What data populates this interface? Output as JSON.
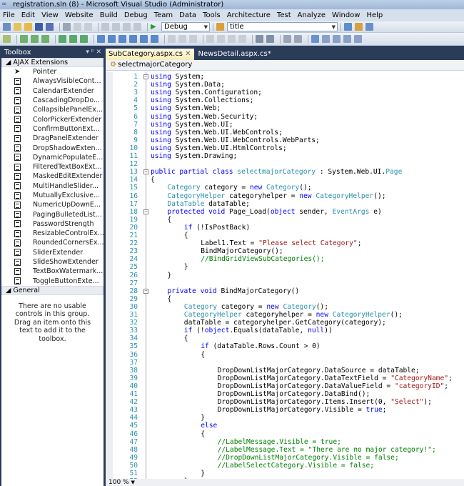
{
  "window": {
    "title": "registration.sln (8) - Microsoft Visual Studio (Administrator)"
  },
  "menu": [
    "File",
    "Edit",
    "View",
    "Website",
    "Build",
    "Debug",
    "Team",
    "Data",
    "Tools",
    "Architecture",
    "Test",
    "Analyze",
    "Window",
    "Help"
  ],
  "toolbar": {
    "config": "Debug",
    "find": "title"
  },
  "colors": {
    "keyword": "#0000ff",
    "type": "#2b91af",
    "string": "#a31515",
    "comment": "#008000",
    "frame": "#2b3c59"
  },
  "toolbox": {
    "title": "Toolbox",
    "controls": "▾ ᵖ ✕",
    "groups": [
      {
        "name": "AJAX Extensions",
        "items": [
          "Pointer",
          "AlwaysVisibleCont...",
          "CalendarExtender",
          "CascadingDropDo...",
          "CollapsiblePanelEx...",
          "ColorPickerExtender",
          "ConfirmButtonExt...",
          "DragPanelExtender",
          "DropShadowExten...",
          "DynamicPopulateE...",
          "FilteredTextBoxExt...",
          "MaskedEditExtender",
          "MultiHandleSlider...",
          "MutuallyExclusive...",
          "NumericUpDownE...",
          "PagingBulletedList...",
          "PasswordStrength",
          "ResizableControlEx...",
          "RoundedCornersEx...",
          "SliderExtender",
          "SlideShowExtender",
          "TextBoxWatermark...",
          "ToggleButtonExte..."
        ]
      },
      {
        "name": "General",
        "items": []
      }
    ],
    "empty_message": "There are no usable controls in this group. Drag an item onto this text to add it to the toolbox."
  },
  "editor": {
    "tabs": [
      {
        "label": "SubCategory.aspx.cs",
        "close": "✕"
      },
      {
        "label": "NewsDetail.aspx.cs*"
      }
    ],
    "nav": "selectmajorCategory",
    "zoom": "100 %",
    "lines": [
      [
        0,
        [
          [
            "kw",
            "using"
          ],
          [
            "pl",
            " System;"
          ]
        ]
      ],
      [
        0,
        [
          [
            "kw",
            "using"
          ],
          [
            "pl",
            " System.Data;"
          ]
        ]
      ],
      [
        0,
        [
          [
            "kw",
            "using"
          ],
          [
            "pl",
            " System.Configuration;"
          ]
        ]
      ],
      [
        0,
        [
          [
            "kw",
            "using"
          ],
          [
            "pl",
            " System.Collections;"
          ]
        ]
      ],
      [
        0,
        [
          [
            "kw",
            "using"
          ],
          [
            "pl",
            " System.Web;"
          ]
        ]
      ],
      [
        0,
        [
          [
            "kw",
            "using"
          ],
          [
            "pl",
            " System.Web.Security;"
          ]
        ]
      ],
      [
        0,
        [
          [
            "kw",
            "using"
          ],
          [
            "pl",
            " System.Web.UI;"
          ]
        ]
      ],
      [
        0,
        [
          [
            "kw",
            "using"
          ],
          [
            "pl",
            " System.Web.UI.WebControls;"
          ]
        ]
      ],
      [
        0,
        [
          [
            "kw",
            "using"
          ],
          [
            "pl",
            " System.Web.UI.WebControls.WebParts;"
          ]
        ]
      ],
      [
        0,
        [
          [
            "kw",
            "using"
          ],
          [
            "pl",
            " System.Web.UI.HtmlControls;"
          ]
        ]
      ],
      [
        0,
        [
          [
            "kw",
            "using"
          ],
          [
            "pl",
            " System.Drawing;"
          ]
        ]
      ],
      [
        0,
        []
      ],
      [
        0,
        [
          [
            "kw",
            "public partial class "
          ],
          [
            "ty",
            "selectmajorCategory"
          ],
          [
            "pl",
            " : System.Web.UI."
          ],
          [
            "ty",
            "Page"
          ]
        ]
      ],
      [
        0,
        [
          [
            "pl",
            "{"
          ]
        ]
      ],
      [
        4,
        [
          [
            "ty",
            "Category"
          ],
          [
            "pl",
            " category = "
          ],
          [
            "kw",
            "new "
          ],
          [
            "ty",
            "Category"
          ],
          [
            "pl",
            "();"
          ]
        ]
      ],
      [
        4,
        [
          [
            "ty",
            "CategoryHelper"
          ],
          [
            "pl",
            " categoryhelper = "
          ],
          [
            "kw",
            "new "
          ],
          [
            "ty",
            "CategoryHelper"
          ],
          [
            "pl",
            "();"
          ]
        ]
      ],
      [
        4,
        [
          [
            "ty",
            "DataTable"
          ],
          [
            "pl",
            " dataTable;"
          ]
        ]
      ],
      [
        4,
        [
          [
            "kw",
            "protected void"
          ],
          [
            "pl",
            " Page_Load("
          ],
          [
            "kw",
            "object"
          ],
          [
            "pl",
            " sender, "
          ],
          [
            "ty",
            "EventArgs"
          ],
          [
            "pl",
            " e)"
          ]
        ]
      ],
      [
        4,
        [
          [
            "pl",
            "{"
          ]
        ]
      ],
      [
        8,
        [
          [
            "kw",
            "if"
          ],
          [
            "pl",
            " (!IsPostBack)"
          ]
        ]
      ],
      [
        8,
        [
          [
            "pl",
            "{"
          ]
        ]
      ],
      [
        12,
        [
          [
            "pl",
            "Label1.Text = "
          ],
          [
            "st",
            "\"Please select Category\""
          ],
          [
            "pl",
            ";"
          ]
        ]
      ],
      [
        12,
        [
          [
            "pl",
            "BindMajorCategory();"
          ]
        ]
      ],
      [
        12,
        [
          [
            "cm",
            "//BindGridViewSubCategories();"
          ]
        ]
      ],
      [
        8,
        [
          [
            "pl",
            "}"
          ]
        ]
      ],
      [
        4,
        [
          [
            "pl",
            "}"
          ]
        ]
      ],
      [
        0,
        []
      ],
      [
        4,
        [
          [
            "kw",
            "private void"
          ],
          [
            "pl",
            " BindMajorCategory()"
          ]
        ]
      ],
      [
        4,
        [
          [
            "pl",
            "{"
          ]
        ]
      ],
      [
        8,
        [
          [
            "ty",
            "Category"
          ],
          [
            "pl",
            " category = "
          ],
          [
            "kw",
            "new "
          ],
          [
            "ty",
            "Category"
          ],
          [
            "pl",
            "();"
          ]
        ]
      ],
      [
        8,
        [
          [
            "ty",
            "CategoryHelper"
          ],
          [
            "pl",
            " categoryhelper = "
          ],
          [
            "kw",
            "new "
          ],
          [
            "ty",
            "CategoryHelper"
          ],
          [
            "pl",
            "();"
          ]
        ]
      ],
      [
        8,
        [
          [
            "pl",
            "dataTable = categoryhelper.GetCategory(category);"
          ]
        ]
      ],
      [
        8,
        [
          [
            "kw",
            "if"
          ],
          [
            "pl",
            " (!"
          ],
          [
            "kw",
            "object"
          ],
          [
            "pl",
            ".Equals(dataTable, "
          ],
          [
            "kw",
            "null"
          ],
          [
            "pl",
            "))"
          ]
        ]
      ],
      [
        8,
        [
          [
            "pl",
            "{"
          ]
        ]
      ],
      [
        12,
        [
          [
            "kw",
            "if"
          ],
          [
            "pl",
            " (dataTable.Rows.Count > 0)"
          ]
        ]
      ],
      [
        12,
        [
          [
            "pl",
            "{"
          ]
        ]
      ],
      [
        0,
        []
      ],
      [
        16,
        [
          [
            "pl",
            "DropDownListMajorCategory.DataSource = dataTable;"
          ]
        ]
      ],
      [
        16,
        [
          [
            "pl",
            "DropDownListMajorCategory.DataTextField = "
          ],
          [
            "st",
            "\"CategoryName\""
          ],
          [
            "pl",
            ";"
          ]
        ]
      ],
      [
        16,
        [
          [
            "pl",
            "DropDownListMajorCategory.DataValueField = "
          ],
          [
            "st",
            "\"categoryID\""
          ],
          [
            "pl",
            ";"
          ]
        ]
      ],
      [
        16,
        [
          [
            "pl",
            "DropDownListMajorCategory.DataBind();"
          ]
        ]
      ],
      [
        16,
        [
          [
            "pl",
            "DropDownListMajorCategory.Items.Insert(0, "
          ],
          [
            "st",
            "\"Select\""
          ],
          [
            "pl",
            ");"
          ]
        ]
      ],
      [
        16,
        [
          [
            "pl",
            "DropDownListMajorCategory.Visible = "
          ],
          [
            "kw",
            "true"
          ],
          [
            "pl",
            ";"
          ]
        ]
      ],
      [
        12,
        [
          [
            "pl",
            "}"
          ]
        ]
      ],
      [
        12,
        [
          [
            "kw",
            "else"
          ]
        ]
      ],
      [
        12,
        [
          [
            "pl",
            "{"
          ]
        ]
      ],
      [
        16,
        [
          [
            "cm",
            "//LabelMessage.Visible = true;"
          ]
        ]
      ],
      [
        16,
        [
          [
            "cm",
            "//LabelMessage.Text = \"There are no major category!\";"
          ]
        ]
      ],
      [
        16,
        [
          [
            "cm",
            "//DropDownListMajorCategory.Visible = false;"
          ]
        ]
      ],
      [
        16,
        [
          [
            "cm",
            "//LabelSelectCategory.Visible = false;"
          ]
        ]
      ],
      [
        12,
        [
          [
            "pl",
            "}"
          ]
        ]
      ],
      [
        8,
        [
          [
            "pl",
            "}"
          ]
        ]
      ]
    ]
  }
}
